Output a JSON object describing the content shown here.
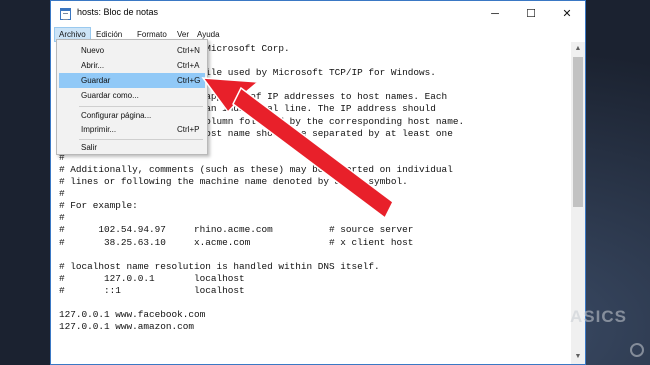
{
  "window": {
    "title": "hosts: Bloc de notas",
    "minimize": "─",
    "maximize": "☐",
    "close": "✕"
  },
  "menubar": [
    "Archivo",
    "Edición",
    "Formato",
    "Ver",
    "Ayuda"
  ],
  "file_menu": [
    {
      "label": "Nuevo",
      "shortcut": "Ctrl+N"
    },
    {
      "label": "Abrir...",
      "shortcut": "Ctrl+A"
    },
    {
      "label": "Guardar",
      "shortcut": "Ctrl+G"
    },
    {
      "label": "Guardar como...",
      "shortcut": ""
    },
    {
      "label": "Configurar página...",
      "shortcut": ""
    },
    {
      "label": "Imprimir...",
      "shortcut": "Ctrl+P"
    },
    {
      "label": "Salir",
      "shortcut": ""
    }
  ],
  "editor_lines": [
    "# Copyright (c) 1993-2009 Microsoft Corp.",
    "#",
    "# This is a sample HOSTS file used by Microsoft TCP/IP for Windows.",
    "#",
    "# This file contains the mappings of IP addresses to host names. Each",
    "# entry should be kept on an individual line. The IP address should",
    "# be placed in the first column followed by the corresponding host name.",
    "# The IP address and the host name should be separated by at least one",
    "# space.",
    "#",
    "# Additionally, comments (such as these) may be inserted on individual",
    "# lines or following the machine name denoted by a '#' symbol.",
    "#",
    "# For example:",
    "#",
    "#      102.54.94.97     rhino.acme.com          # source server",
    "#       38.25.63.10     x.acme.com              # x client host",
    "",
    "# localhost name resolution is handled within DNS itself.",
    "#       127.0.0.1       localhost",
    "#       ::1             localhost",
    "",
    "127.0.0.1 www.facebook.com",
    "127.0.0.1 www.amazon.com"
  ],
  "watermark": "ASICS",
  "colors": {
    "arrow": "#e8202a",
    "menu_highlight": "#91c9f7",
    "window_border": "#3a78c4"
  }
}
